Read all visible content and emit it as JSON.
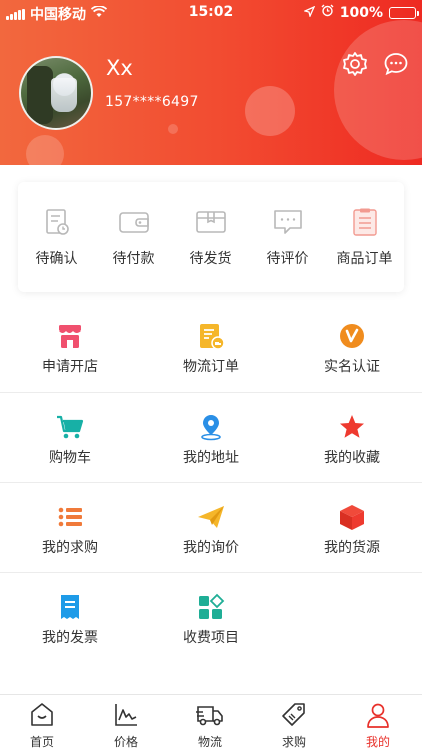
{
  "status_bar": {
    "carrier": "中国移动",
    "time": "15:02",
    "battery": "100%"
  },
  "profile": {
    "name": "Xx",
    "phone": "157****6497"
  },
  "orders": [
    {
      "label": "待确认",
      "icon": "document-clock-icon"
    },
    {
      "label": "待付款",
      "icon": "wallet-icon"
    },
    {
      "label": "待发货",
      "icon": "package-box-icon"
    },
    {
      "label": "待评价",
      "icon": "comment-bubble-icon"
    },
    {
      "label": "商品订单",
      "icon": "clipboard-list-icon"
    }
  ],
  "grid": [
    {
      "label": "申请开店",
      "icon": "store-icon"
    },
    {
      "label": "物流订单",
      "icon": "logistics-document-icon"
    },
    {
      "label": "实名认证",
      "icon": "verified-badge-icon"
    },
    {
      "label": "购物车",
      "icon": "shopping-cart-icon"
    },
    {
      "label": "我的地址",
      "icon": "location-pin-icon"
    },
    {
      "label": "我的收藏",
      "icon": "star-icon"
    },
    {
      "label": "我的求购",
      "icon": "list-icon"
    },
    {
      "label": "我的询价",
      "icon": "paper-plane-icon"
    },
    {
      "label": "我的货源",
      "icon": "cube-icon"
    },
    {
      "label": "我的发票",
      "icon": "invoice-icon"
    },
    {
      "label": "收费项目",
      "icon": "apps-grid-icon"
    }
  ],
  "tabs": [
    {
      "label": "首页",
      "icon": "home-icon"
    },
    {
      "label": "价格",
      "icon": "price-chart-icon"
    },
    {
      "label": "物流",
      "icon": "truck-icon"
    },
    {
      "label": "求购",
      "icon": "tag-icon"
    },
    {
      "label": "我的",
      "icon": "user-icon",
      "active": true
    }
  ],
  "colors": {
    "brand": "#ee2a22",
    "active_tab": "#e8302a"
  }
}
